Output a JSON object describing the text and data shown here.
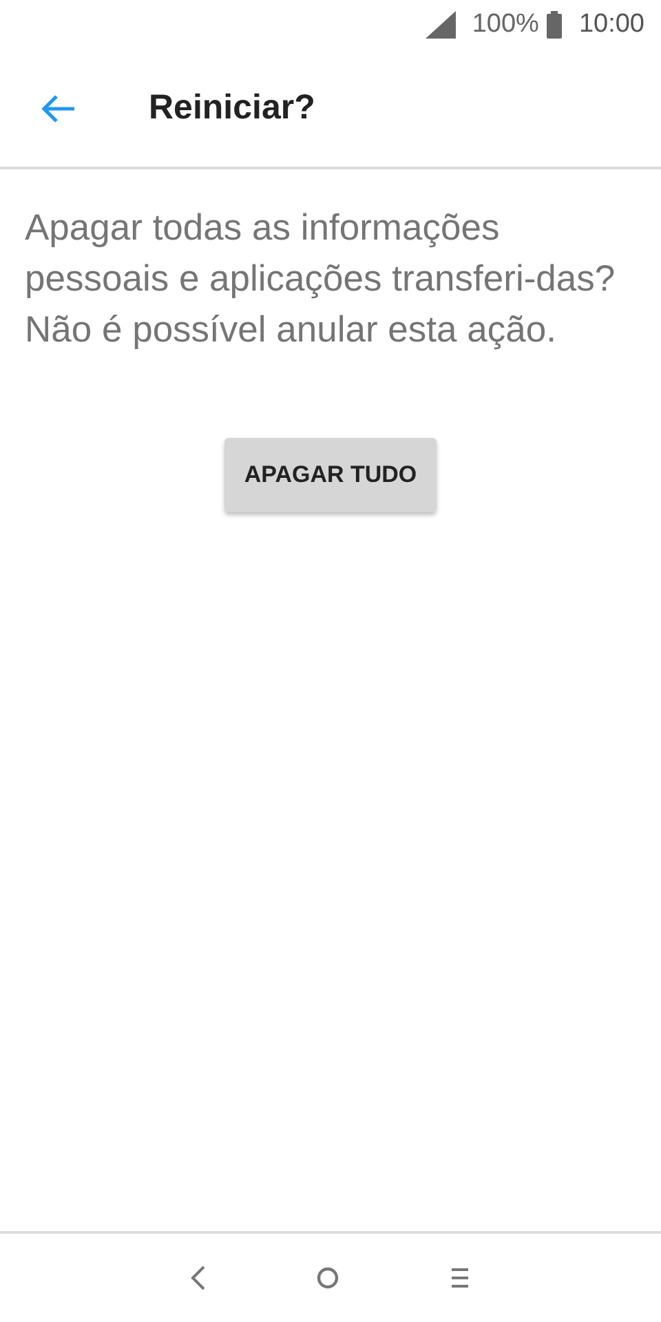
{
  "status_bar": {
    "battery": "100%",
    "time": "10:00"
  },
  "app_bar": {
    "title": "Reiniciar?"
  },
  "message": "Apagar todas as informações pessoais e aplicações transferi-das? Não é possível anular esta ação.",
  "buttons": [
    "APAGAR TUDO"
  ]
}
